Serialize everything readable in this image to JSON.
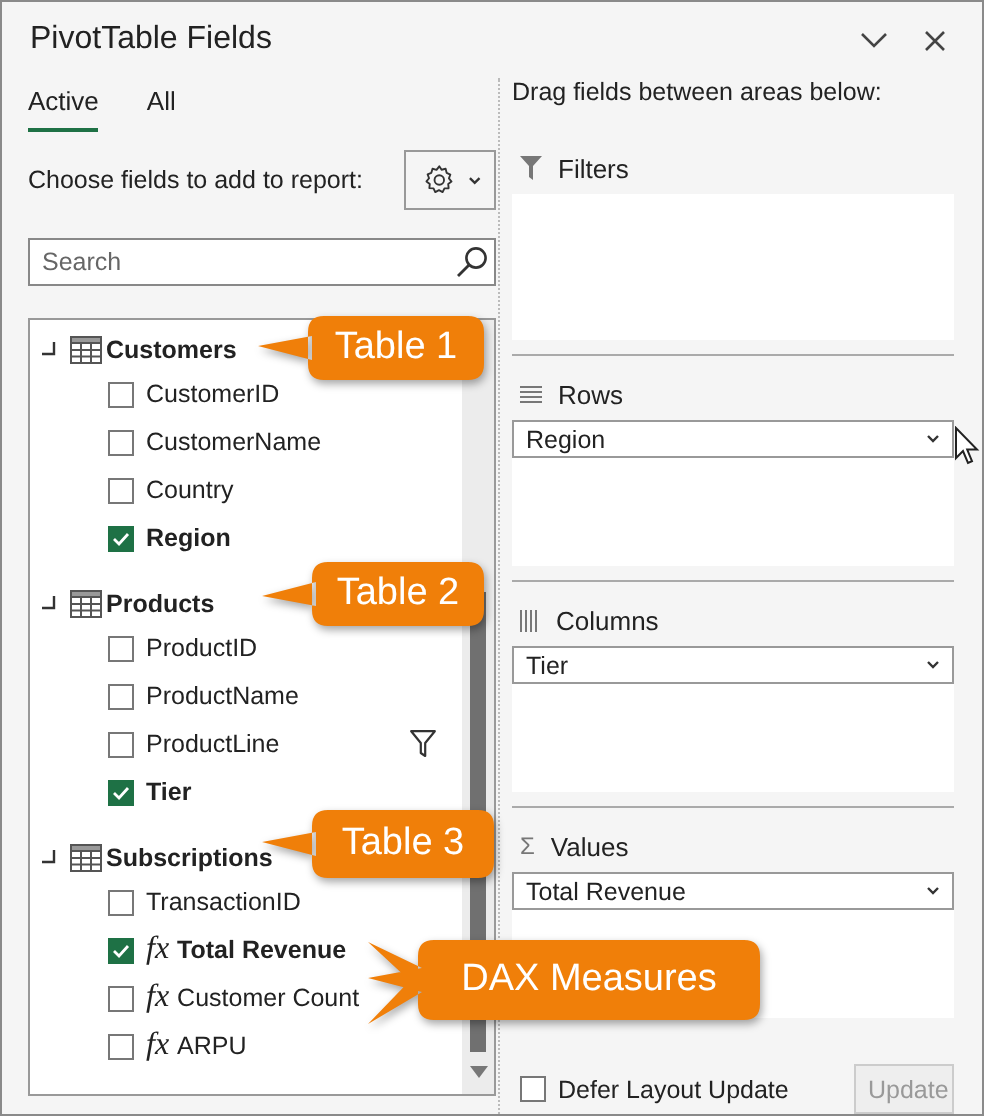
{
  "window": {
    "title": "PivotTable Fields"
  },
  "tabs": [
    {
      "label": "Active",
      "selected": true
    },
    {
      "label": "All",
      "selected": false
    }
  ],
  "choose_label": "Choose fields to add to report:",
  "search": {
    "placeholder": "Search"
  },
  "tables": [
    {
      "name": "Customers",
      "fields": [
        {
          "name": "CustomerID",
          "checked": false,
          "kind": "column"
        },
        {
          "name": "CustomerName",
          "checked": false,
          "kind": "column"
        },
        {
          "name": "Country",
          "checked": false,
          "kind": "column"
        },
        {
          "name": "Region",
          "checked": true,
          "kind": "column"
        }
      ]
    },
    {
      "name": "Products",
      "fields": [
        {
          "name": "ProductID",
          "checked": false,
          "kind": "column"
        },
        {
          "name": "ProductName",
          "checked": false,
          "kind": "column"
        },
        {
          "name": "ProductLine",
          "checked": false,
          "kind": "column",
          "filtered": true
        },
        {
          "name": "Tier",
          "checked": true,
          "kind": "column"
        }
      ]
    },
    {
      "name": "Subscriptions",
      "fields": [
        {
          "name": "TransactionID",
          "checked": false,
          "kind": "column"
        },
        {
          "name": "Total Revenue",
          "checked": true,
          "kind": "measure",
          "symbol": "fx"
        },
        {
          "name": "Customer Count",
          "checked": false,
          "kind": "measure",
          "symbol": "fx"
        },
        {
          "name": "ARPU",
          "checked": false,
          "kind": "measure",
          "symbol": "fx"
        }
      ]
    }
  ],
  "areas_hint": "Drag fields between areas below:",
  "areas": [
    {
      "kind": "filters",
      "label": "Filters"
    },
    {
      "kind": "rows",
      "label": "Rows",
      "fields": [
        "Region"
      ]
    },
    {
      "kind": "columns",
      "label": "Columns",
      "fields": [
        "Tier"
      ]
    },
    {
      "kind": "values",
      "label": "Values",
      "symbol": "Σ",
      "fields": [
        "Total Revenue"
      ]
    }
  ],
  "defer": {
    "label": "Defer Layout Update",
    "checked": false
  },
  "update_button": {
    "label": "Update",
    "disabled": true
  },
  "callouts": [
    {
      "text": "Table 1"
    },
    {
      "text": "Table 2"
    },
    {
      "text": "Table 3"
    },
    {
      "text": "DAX Measures"
    }
  ]
}
